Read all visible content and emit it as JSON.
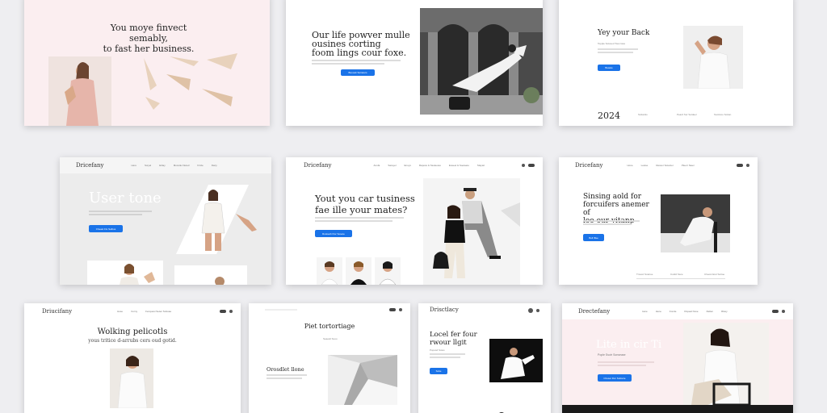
{
  "cards": {
    "c1": {
      "headline_1": "You moye finvect semably,",
      "headline_2": "to fast her business."
    },
    "c2": {
      "headline_1": "Our life powver mulle",
      "headline_2": "ousines corting",
      "headline_3": "foom lings cour foxe.",
      "button": "Booook Sorieters"
    },
    "c3": {
      "headline": "Yey your Back",
      "sub": "Topple Solveed Tous Iase",
      "button": "Boaste",
      "year": "2024",
      "footer": [
        "Sottantio",
        "Peard Sor Sotdeer",
        "Soottcoo Sottan"
      ]
    },
    "c4": {
      "logo": "Dricefany",
      "nav": [
        "Here",
        "Soiyel",
        "Erliay",
        "Mocotle Fleted",
        "Fircle",
        "Dariy"
      ],
      "hero": "User tone",
      "button": "Cheast Flo Selbus"
    },
    "c5": {
      "logo": "Dricefany",
      "nav": [
        "Anofa",
        "Sareyel",
        "Enuys",
        "Raposs & Ssoleetes",
        "Eoseet & Soetaeto",
        "Slaytel"
      ],
      "headline_1": "Yout you car tusiness",
      "headline_2": "fae ille your mates?",
      "button": "Rosiseib Flor Sosete"
    },
    "c6": {
      "logo": "Dricefany",
      "nav": [
        "Hone",
        "Lesise",
        "Ressor Sotetcer",
        "Pleerr Sieel"
      ],
      "headline_1": "Sinsing aold for",
      "headline_2": "forcuifers anemer of",
      "headline_3": "loo our vitanp",
      "button": "Boll Iffee",
      "footer": [
        "Trouaz Sotetoe",
        "Cotdd Ssce",
        "Cheost Erel Sottoe"
      ]
    },
    "c7": {
      "logo": "Driucifany",
      "nav": [
        "Hose",
        "Corny",
        "Fenquesi Setec Sottoae"
      ],
      "headline": "Wolking pelicotls",
      "sub": "yous tritice d-arrubs cers oud gotid."
    },
    "c8": {
      "headline": "Piet tortortiage",
      "sub": "Seaesil Sooo",
      "headline_2": "Orosdlet llone"
    },
    "c9": {
      "logo": "Drisctlacy",
      "headline_1": "Locel fer four",
      "headline_2": "rwour llgit",
      "sub": "Poposd Sotes",
      "button": "Sotie"
    },
    "c10": {
      "logo": "Drectefany",
      "nav": [
        "Here",
        "Hene",
        "Fonde",
        "Rspeal Nove",
        "Rellen",
        "Rlaxy"
      ],
      "hero": "Lite in cir Ti",
      "sub": "Pople Ssotr Sonsease",
      "button": "Choset Flor Sollonte"
    }
  }
}
